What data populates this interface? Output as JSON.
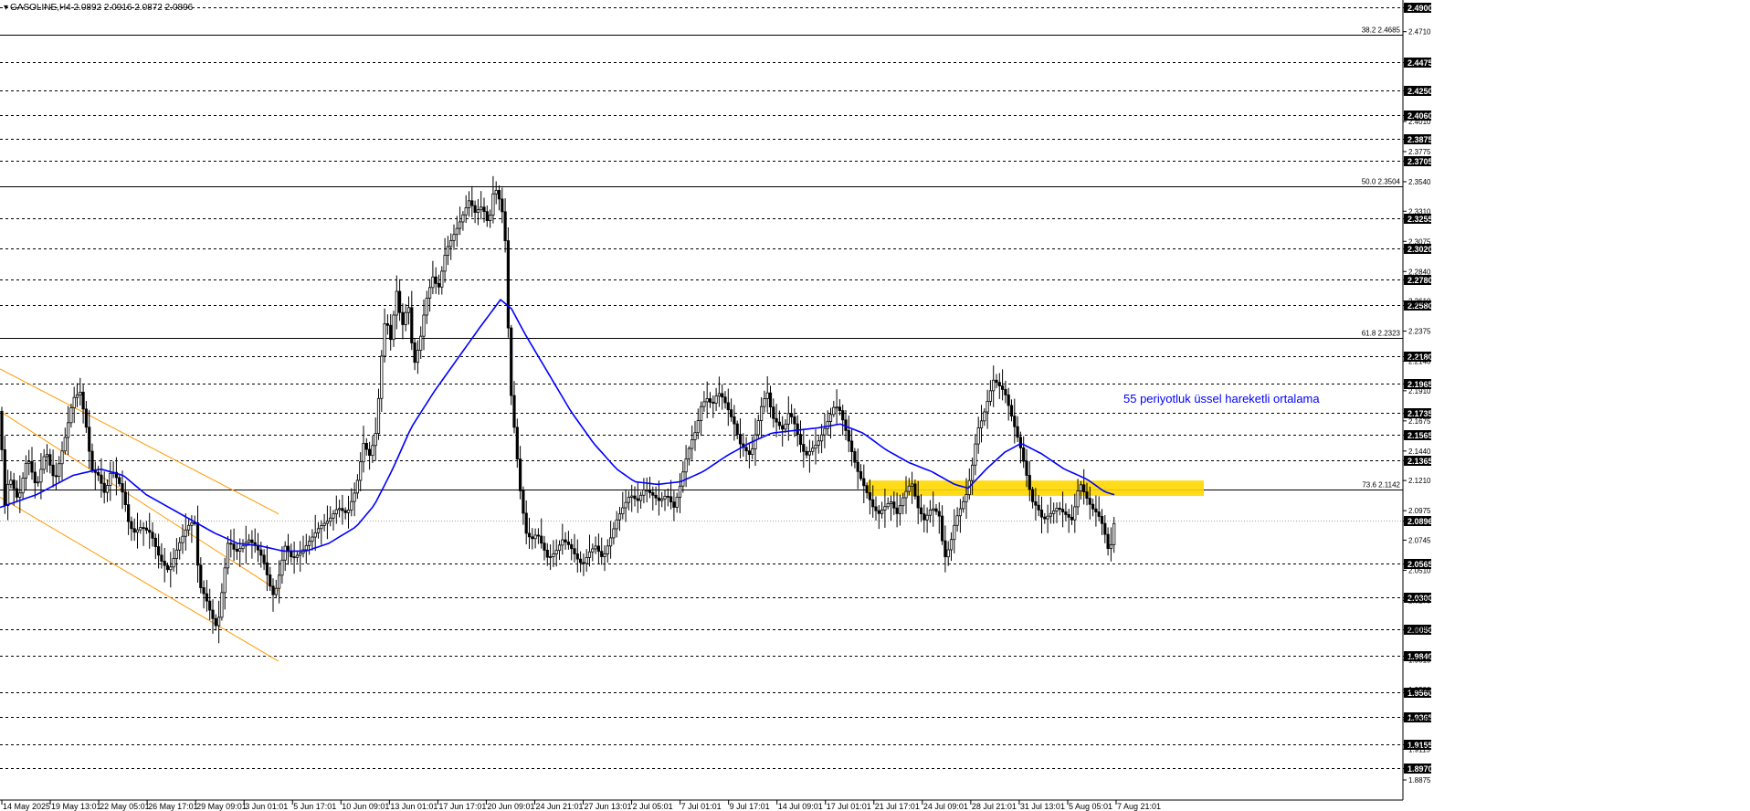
{
  "header": {
    "symbol": "GASOLINE,H4",
    "ohlc": "2.0892 2.0916 2.0872 2.0896"
  },
  "annotation": "55 periyotluk üssel hareketli ortalama",
  "colors": {
    "background": "#ffffff",
    "candle": "#000000",
    "ema": "#0000ff",
    "channel": "#ff9900",
    "zone": "#ffd700",
    "grid": "#000000",
    "price_badge": "#000000",
    "annotation": "#0000ff"
  },
  "chart_data": {
    "type": "candlestick",
    "ylim": [
      1.8875,
      2.49
    ],
    "grid": "dashed horizontal at marked levels",
    "current_price": "2.0896",
    "price_levels": [
      "2.4900",
      "2.4475",
      "2.4250",
      "2.4060",
      "2.3875",
      "2.3705",
      "2.3255",
      "2.3020",
      "2.2780",
      "2.2580",
      "2.2180",
      "2.1965",
      "2.1735",
      "2.1565",
      "2.1365",
      "2.0896",
      "2.0565",
      "2.0300",
      "2.0050",
      "1.9840",
      "1.9560",
      "1.9365",
      "1.9155",
      "1.8970"
    ],
    "axis_ticks": [
      "2.4710",
      "2.4010",
      "2.3775",
      "2.3540",
      "2.3310",
      "2.3075",
      "2.2840",
      "2.2610",
      "2.2375",
      "2.2140",
      "2.1910",
      "2.1675",
      "2.1440",
      "2.1210",
      "2.0975",
      "2.0745",
      "2.0510",
      "2.0275",
      "2.0045",
      "1.9810",
      "1.9580",
      "1.9345",
      "1.9115",
      "1.8875"
    ],
    "fibonacci": [
      {
        "label": "38.2 2.4685",
        "value": 2.4685
      },
      {
        "label": "50.0 2.3504",
        "value": 2.3504
      },
      {
        "label": "61.8 2.2323",
        "value": 2.2323
      },
      {
        "label": "73.6 2.1142",
        "value": 2.1142
      }
    ],
    "time_labels": [
      "14 May 2025",
      "19 May 13:01",
      "22 May 05:01",
      "26 May 17:01",
      "29 May 09:01",
      "3 Jun 01:01",
      "5 Jun 17:01",
      "10 Jun 09:01",
      "13 Jun 01:01",
      "17 Jun 17:01",
      "20 Jun 09:01",
      "24 Jun 21:01",
      "27 Jun 13:01",
      "2 Jul 05:01",
      "7 Jul 01:01",
      "9 Jul 17:01",
      "14 Jul 09:01",
      "17 Jul 01:01",
      "21 Jul 17:01",
      "24 Jul 09:01",
      "28 Jul 21:01",
      "31 Jul 13:01",
      "5 Aug 05:01",
      "7 Aug 21:01"
    ],
    "price_path": [
      [
        0,
        2.175
      ],
      [
        5,
        2.1
      ],
      [
        10,
        2.125
      ],
      [
        20,
        2.105
      ],
      [
        30,
        2.14
      ],
      [
        40,
        2.115
      ],
      [
        50,
        2.145
      ],
      [
        60,
        2.12
      ],
      [
        70,
        2.15
      ],
      [
        80,
        2.185
      ],
      [
        88,
        2.19
      ],
      [
        95,
        2.16
      ],
      [
        100,
        2.13
      ],
      [
        108,
        2.125
      ],
      [
        115,
        2.11
      ],
      [
        122,
        2.13
      ],
      [
        130,
        2.12
      ],
      [
        136,
        2.108
      ],
      [
        140,
        2.09
      ],
      [
        146,
        2.08
      ],
      [
        155,
        2.085
      ],
      [
        165,
        2.08
      ],
      [
        175,
        2.06
      ],
      [
        185,
        2.05
      ],
      [
        195,
        2.07
      ],
      [
        205,
        2.085
      ],
      [
        213,
        2.09
      ],
      [
        218,
        2.04
      ],
      [
        225,
        2.03
      ],
      [
        232,
        2.015
      ],
      [
        238,
        2.005
      ],
      [
        244,
        2.04
      ],
      [
        250,
        2.075
      ],
      [
        258,
        2.065
      ],
      [
        266,
        2.07
      ],
      [
        272,
        2.075
      ],
      [
        280,
        2.07
      ],
      [
        288,
        2.06
      ],
      [
        295,
        2.04
      ],
      [
        300,
        2.03
      ],
      [
        305,
        2.045
      ],
      [
        312,
        2.07
      ],
      [
        320,
        2.06
      ],
      [
        330,
        2.065
      ],
      [
        340,
        2.075
      ],
      [
        350,
        2.085
      ],
      [
        360,
        2.09
      ],
      [
        370,
        2.1
      ],
      [
        380,
        2.095
      ],
      [
        390,
        2.115
      ],
      [
        398,
        2.15
      ],
      [
        405,
        2.14
      ],
      [
        412,
        2.16
      ],
      [
        418,
        2.22
      ],
      [
        422,
        2.25
      ],
      [
        428,
        2.23
      ],
      [
        434,
        2.27
      ],
      [
        440,
        2.24
      ],
      [
        447,
        2.26
      ],
      [
        453,
        2.21
      ],
      [
        460,
        2.23
      ],
      [
        466,
        2.26
      ],
      [
        474,
        2.28
      ],
      [
        480,
        2.27
      ],
      [
        488,
        2.3
      ],
      [
        495,
        2.31
      ],
      [
        502,
        2.32
      ],
      [
        508,
        2.33
      ],
      [
        514,
        2.34
      ],
      [
        520,
        2.33
      ],
      [
        528,
        2.335
      ],
      [
        535,
        2.32
      ],
      [
        541,
        2.35
      ],
      [
        545,
        2.345
      ],
      [
        550,
        2.33
      ],
      [
        553,
        2.31
      ],
      [
        556,
        2.25
      ],
      [
        558,
        2.2
      ],
      [
        562,
        2.17
      ],
      [
        566,
        2.14
      ],
      [
        570,
        2.11
      ],
      [
        576,
        2.08
      ],
      [
        582,
        2.075
      ],
      [
        588,
        2.08
      ],
      [
        594,
        2.07
      ],
      [
        600,
        2.06
      ],
      [
        608,
        2.065
      ],
      [
        616,
        2.075
      ],
      [
        624,
        2.07
      ],
      [
        632,
        2.06
      ],
      [
        638,
        2.055
      ],
      [
        645,
        2.065
      ],
      [
        652,
        2.07
      ],
      [
        660,
        2.06
      ],
      [
        668,
        2.075
      ],
      [
        675,
        2.09
      ],
      [
        682,
        2.1
      ],
      [
        690,
        2.11
      ],
      [
        698,
        2.105
      ],
      [
        706,
        2.115
      ],
      [
        714,
        2.11
      ],
      [
        722,
        2.105
      ],
      [
        730,
        2.11
      ],
      [
        738,
        2.1
      ],
      [
        744,
        2.115
      ],
      [
        750,
        2.135
      ],
      [
        756,
        2.15
      ],
      [
        762,
        2.16
      ],
      [
        768,
        2.18
      ],
      [
        774,
        2.185
      ],
      [
        780,
        2.18
      ],
      [
        786,
        2.19
      ],
      [
        792,
        2.185
      ],
      [
        798,
        2.175
      ],
      [
        804,
        2.165
      ],
      [
        810,
        2.15
      ],
      [
        816,
        2.145
      ],
      [
        822,
        2.14
      ],
      [
        828,
        2.16
      ],
      [
        834,
        2.18
      ],
      [
        840,
        2.19
      ],
      [
        846,
        2.17
      ],
      [
        852,
        2.165
      ],
      [
        858,
        2.16
      ],
      [
        864,
        2.175
      ],
      [
        870,
        2.165
      ],
      [
        876,
        2.15
      ],
      [
        882,
        2.14
      ],
      [
        888,
        2.145
      ],
      [
        895,
        2.15
      ],
      [
        902,
        2.16
      ],
      [
        908,
        2.17
      ],
      [
        914,
        2.18
      ],
      [
        920,
        2.175
      ],
      [
        926,
        2.16
      ],
      [
        932,
        2.145
      ],
      [
        938,
        2.13
      ],
      [
        944,
        2.12
      ],
      [
        950,
        2.11
      ],
      [
        956,
        2.1
      ],
      [
        962,
        2.095
      ],
      [
        968,
        2.1
      ],
      [
        975,
        2.105
      ],
      [
        982,
        2.095
      ],
      [
        990,
        2.11
      ],
      [
        998,
        2.12
      ],
      [
        1005,
        2.1
      ],
      [
        1012,
        2.09
      ],
      [
        1020,
        2.1
      ],
      [
        1028,
        2.095
      ],
      [
        1034,
        2.06
      ],
      [
        1040,
        2.07
      ],
      [
        1046,
        2.09
      ],
      [
        1052,
        2.1
      ],
      [
        1058,
        2.11
      ],
      [
        1064,
        2.13
      ],
      [
        1070,
        2.16
      ],
      [
        1076,
        2.17
      ],
      [
        1082,
        2.185
      ],
      [
        1088,
        2.2
      ],
      [
        1094,
        2.195
      ],
      [
        1100,
        2.19
      ],
      [
        1106,
        2.175
      ],
      [
        1112,
        2.16
      ],
      [
        1118,
        2.145
      ],
      [
        1124,
        2.125
      ],
      [
        1130,
        2.105
      ],
      [
        1136,
        2.1
      ],
      [
        1142,
        2.09
      ],
      [
        1150,
        2.095
      ],
      [
        1158,
        2.1
      ],
      [
        1166,
        2.095
      ],
      [
        1174,
        2.09
      ],
      [
        1182,
        2.12
      ],
      [
        1188,
        2.11
      ],
      [
        1195,
        2.1
      ],
      [
        1202,
        2.095
      ],
      [
        1208,
        2.085
      ],
      [
        1214,
        2.065
      ],
      [
        1218,
        2.075
      ],
      [
        1220,
        2.0896
      ]
    ],
    "ema55_path": [
      [
        0,
        2.1
      ],
      [
        40,
        2.11
      ],
      [
        80,
        2.125
      ],
      [
        110,
        2.13
      ],
      [
        135,
        2.125
      ],
      [
        160,
        2.11
      ],
      [
        185,
        2.1
      ],
      [
        210,
        2.09
      ],
      [
        235,
        2.08
      ],
      [
        260,
        2.072
      ],
      [
        285,
        2.07
      ],
      [
        310,
        2.066
      ],
      [
        335,
        2.066
      ],
      [
        360,
        2.072
      ],
      [
        390,
        2.085
      ],
      [
        410,
        2.102
      ],
      [
        430,
        2.13
      ],
      [
        450,
        2.162
      ],
      [
        475,
        2.19
      ],
      [
        500,
        2.215
      ],
      [
        525,
        2.24
      ],
      [
        548,
        2.262
      ],
      [
        560,
        2.255
      ],
      [
        575,
        2.235
      ],
      [
        600,
        2.205
      ],
      [
        625,
        2.175
      ],
      [
        650,
        2.15
      ],
      [
        675,
        2.13
      ],
      [
        695,
        2.12
      ],
      [
        720,
        2.118
      ],
      [
        745,
        2.12
      ],
      [
        770,
        2.128
      ],
      [
        795,
        2.14
      ],
      [
        820,
        2.15
      ],
      [
        845,
        2.158
      ],
      [
        870,
        2.16
      ],
      [
        895,
        2.162
      ],
      [
        920,
        2.165
      ],
      [
        945,
        2.158
      ],
      [
        970,
        2.145
      ],
      [
        995,
        2.135
      ],
      [
        1020,
        2.128
      ],
      [
        1045,
        2.118
      ],
      [
        1060,
        2.115
      ],
      [
        1080,
        2.13
      ],
      [
        1100,
        2.143
      ],
      [
        1118,
        2.15
      ],
      [
        1140,
        2.142
      ],
      [
        1165,
        2.13
      ],
      [
        1190,
        2.122
      ],
      [
        1210,
        2.112
      ],
      [
        1220,
        2.11
      ]
    ],
    "channel_upper": [
      [
        0,
        2.208
      ],
      [
        305,
        2.095
      ]
    ],
    "channel_middle": [
      [
        0,
        2.175
      ],
      [
        305,
        2.035
      ]
    ],
    "channel_lower": [
      [
        0,
        2.108
      ],
      [
        305,
        1.98
      ]
    ],
    "yellow_zone": {
      "x_range": [
        950,
        1318
      ],
      "y_range": [
        2.109,
        2.121
      ]
    }
  }
}
